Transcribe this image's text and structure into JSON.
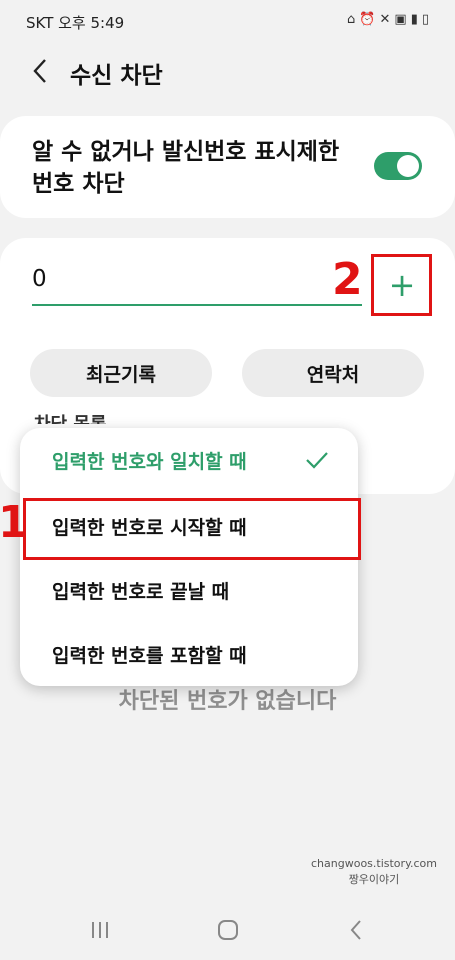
{
  "status_bar": {
    "carrier_time": "SKT 오후 5:49",
    "icons": [
      "home-alert-icon",
      "alarm-icon",
      "mute-icon",
      "5g-icon",
      "signal-icon",
      "battery-icon"
    ]
  },
  "app_bar": {
    "title": "수신 차단"
  },
  "unknown_block": {
    "label": "알 수 없거나 발신번호 표시제한 번호 차단",
    "enabled": true
  },
  "add_number": {
    "value": "0",
    "add_label": "+"
  },
  "buttons": {
    "recent": "최근기록",
    "contacts": "연락처"
  },
  "match_menu": {
    "options": [
      {
        "label": "입력한 번호와 일치할 때",
        "selected": true
      },
      {
        "label": "입력한 번호로 시작할 때",
        "selected": false
      },
      {
        "label": "입력한 번호로 끝날 때",
        "selected": false
      },
      {
        "label": "입력한 번호를 포함할 때",
        "selected": false
      }
    ]
  },
  "hidden_label": "차단 목록",
  "empty_message": "차단된 번호가 없습니다",
  "annotations": {
    "step1": "1",
    "step2": "2",
    "color": "#e01414"
  },
  "watermark": {
    "line1": "changwoos.tistory.com",
    "line2": "짱우이야기"
  },
  "accent_color": "#2e9e6a"
}
